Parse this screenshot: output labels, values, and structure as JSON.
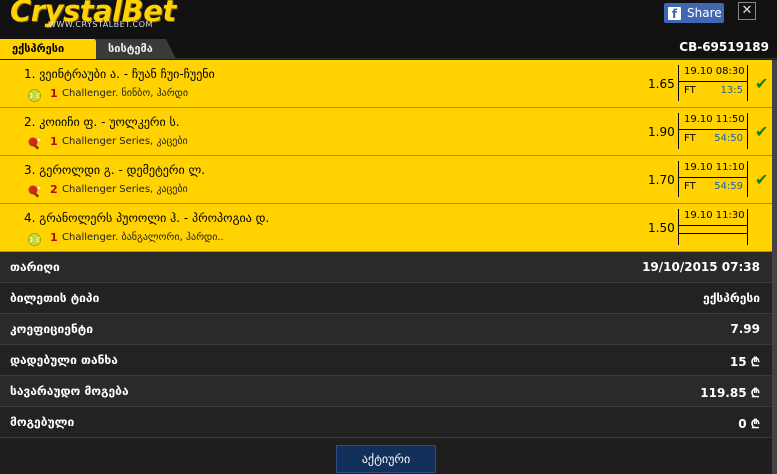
{
  "header": {
    "logo_text": "CrystalBet",
    "logo_sub": "WWW.CRYSTALBET.COM",
    "share_label": "Share",
    "close_label": "✕"
  },
  "tabs": [
    {
      "label": "ექსპრესი",
      "active": true
    },
    {
      "label": "სისტემა",
      "active": false
    }
  ],
  "ticket_id": "CB-69519189",
  "bets": [
    {
      "title": "1. ვეინტრაუბი ა. - ჩუან ჩუი-ჩუენი",
      "sport_icon": "tennis-ball-icon",
      "count": "1",
      "league": "Challenger. ნინბო, ჰარდი",
      "odds": "1.65",
      "date": "19.10 08:30",
      "status": "FT",
      "score": "13:5",
      "won": true
    },
    {
      "title": "2. კოიიჩი ფ. - უოლკერი ს.",
      "sport_icon": "table-tennis-icon",
      "count": "1",
      "league": "Challenger Series, კაცები",
      "odds": "1.90",
      "date": "19.10 11:50",
      "status": "FT",
      "score": "54:50",
      "won": true
    },
    {
      "title": "3. გეროლდი გ. - დემეტერი ლ.",
      "sport_icon": "table-tennis-icon",
      "count": "2",
      "league": "Challenger Series, კაცები",
      "odds": "1.70",
      "date": "19.10 11:10",
      "status": "FT",
      "score": "54:59",
      "won": true
    },
    {
      "title": "4. გრანოლერს პუოოლი ჰ. - პროპოგია დ.",
      "sport_icon": "tennis-ball-icon",
      "count": "1",
      "league": "Challenger. ბანგალორი, ჰარდი..",
      "odds": "1.50",
      "date": "19.10 11:30",
      "status": "",
      "score": "",
      "won": false
    }
  ],
  "summary": [
    {
      "label": "თარიღი",
      "value": "19/10/2015 07:38"
    },
    {
      "label": "ბილეთის ტიპი",
      "value": "ექსპრესი"
    },
    {
      "label": "კოეფიციენტი",
      "value": "7.99"
    },
    {
      "label": "დადებული თანხა",
      "value": "15 ₾"
    },
    {
      "label": "სავარაუდო მოგება",
      "value": "119.85 ₾"
    },
    {
      "label": "მოგებული",
      "value": "0 ₾"
    }
  ],
  "footer": {
    "status_label": "აქტიური"
  },
  "colors": {
    "accent": "#ffd200",
    "background": "#1e1e1e",
    "win_check": "#1b7d15",
    "score": "#2060b0",
    "status_button": "#12305a"
  }
}
